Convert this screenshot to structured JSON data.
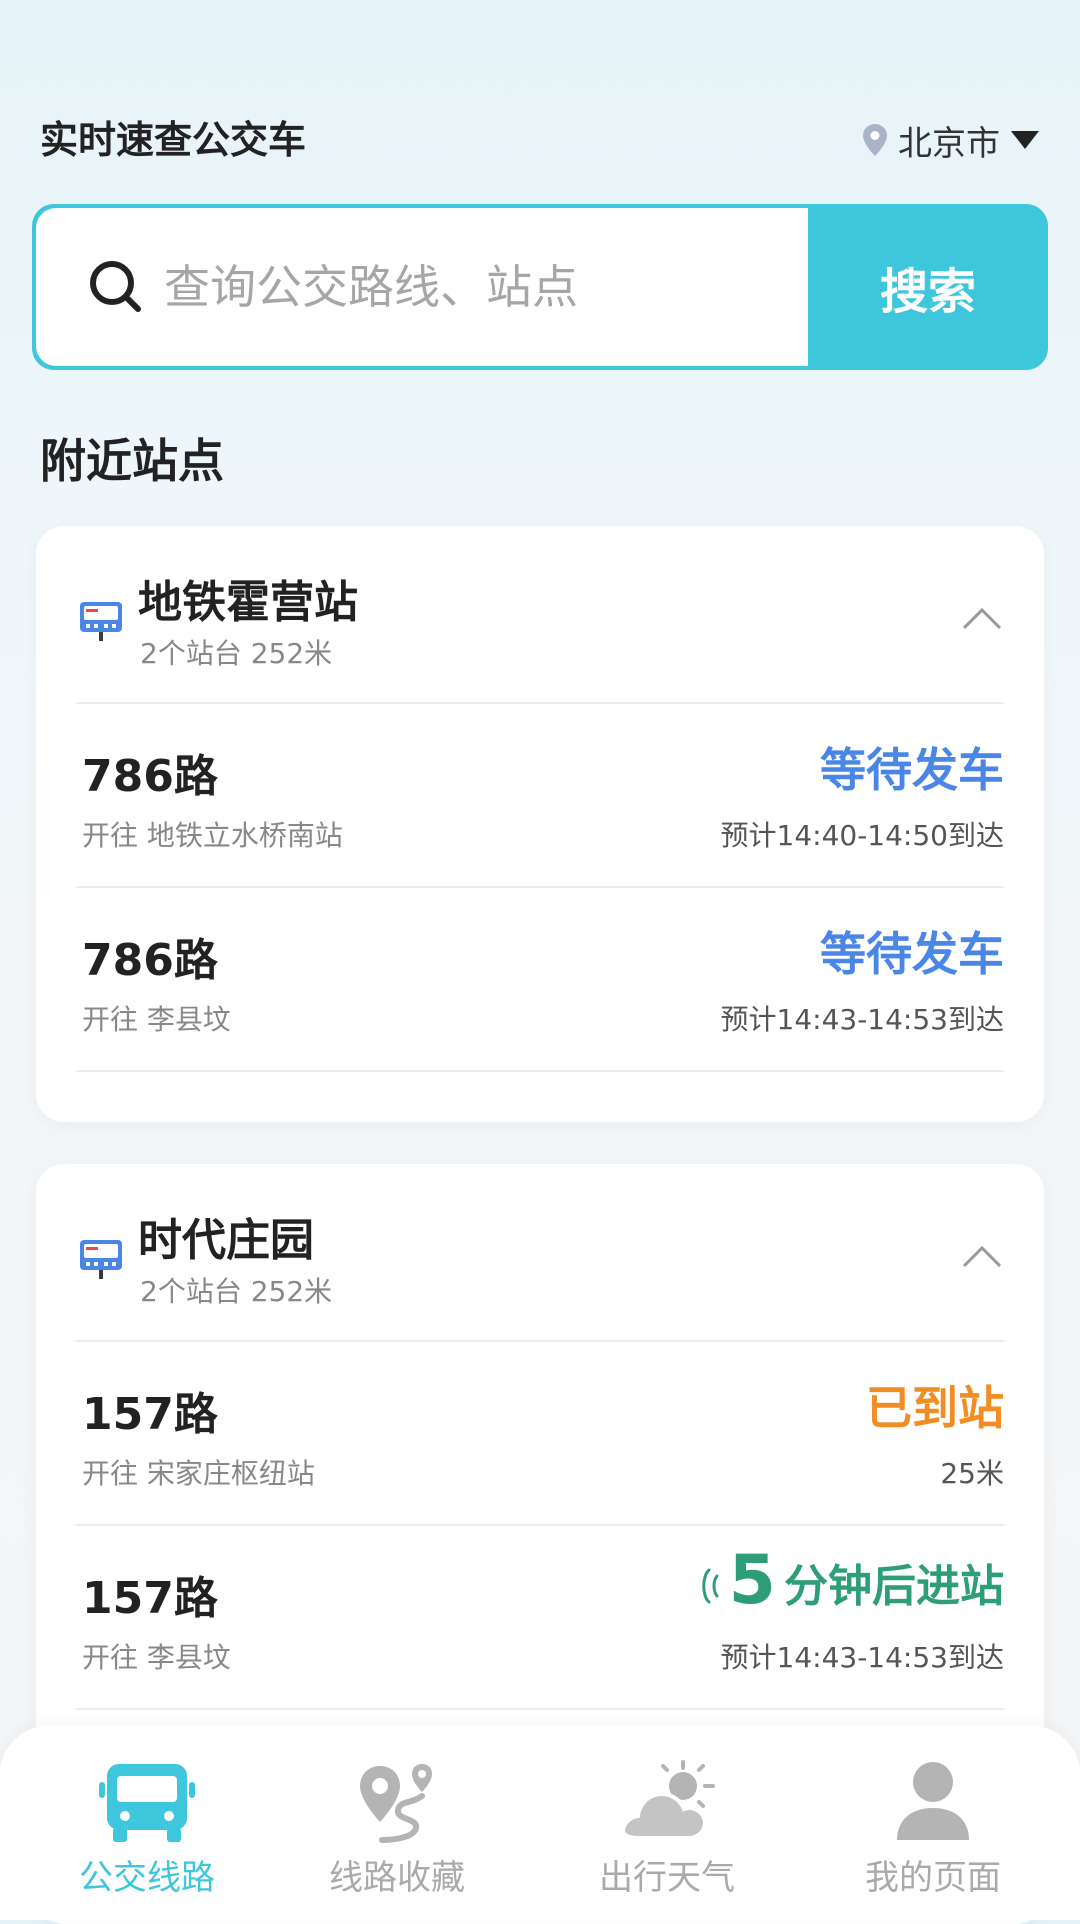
{
  "header": {
    "title": "实时速查公交车",
    "city": "北京市"
  },
  "search": {
    "placeholder": "查询公交路线、站点",
    "button": "搜索"
  },
  "section_title": "附近站点",
  "stops": [
    {
      "name": "地铁霍营站",
      "sub": "2个站台 252米",
      "routes": [
        {
          "name": "786路",
          "dest": "开往 地铁立水桥南站",
          "status": "等待发车",
          "eta": "预计14:40-14:50到达"
        },
        {
          "name": "786路",
          "dest": "开往 李县坟",
          "status": "等待发车",
          "eta": "预计14:43-14:53到达"
        }
      ]
    },
    {
      "name": "时代庄园",
      "sub": "2个站台 252米",
      "routes": [
        {
          "name": "157路",
          "dest": "开往 宋家庄枢纽站",
          "status": "已到站",
          "eta": "25米"
        },
        {
          "name": "157路",
          "dest": "开往 李县坟",
          "status_number": "5",
          "status_text": "分钟后进站",
          "eta": "预计14:43-14:53到达"
        }
      ]
    }
  ],
  "tabs": [
    {
      "label": "公交线路",
      "icon": "bus-icon"
    },
    {
      "label": "线路收藏",
      "icon": "route-pin-icon"
    },
    {
      "label": "出行天气",
      "icon": "weather-icon"
    },
    {
      "label": "我的页面",
      "icon": "user-icon"
    }
  ],
  "colors": {
    "accent": "#3ec6dc",
    "waiting": "#4a86e6",
    "arrived": "#f18d22",
    "coming": "#2e9e79"
  }
}
